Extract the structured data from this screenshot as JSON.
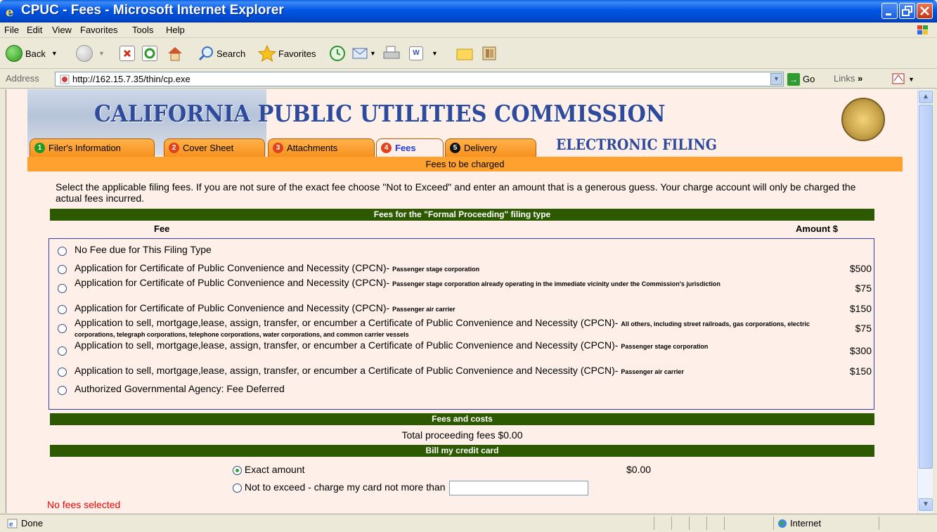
{
  "window": {
    "title": "CPUC - Fees - Microsoft Internet Explorer"
  },
  "menu": [
    "File",
    "Edit",
    "View",
    "Favorites",
    "Tools",
    "Help"
  ],
  "toolbar": {
    "back": "Back",
    "search": "Search",
    "favorites": "Favorites"
  },
  "address": {
    "label": "Address",
    "url": "http://162.15.7.35/thin/cp.exe",
    "go": "Go",
    "links": "Links"
  },
  "banner": {
    "title": "CALIFORNIA PUBLIC UTILITIES COMMISSION",
    "subtitle": "ELECTRONIC FILING"
  },
  "tabs": [
    {
      "num": "1",
      "label": "Filer's Information",
      "color": "#1f9a1f"
    },
    {
      "num": "2",
      "label": "Cover Sheet",
      "color": "#e2421a"
    },
    {
      "num": "3",
      "label": "Attachments",
      "color": "#e2421a"
    },
    {
      "num": "4",
      "label": "Fees",
      "color": "#e2421a"
    },
    {
      "num": "5",
      "label": "Delivery",
      "color": "#111111"
    }
  ],
  "page": {
    "header": "Fees to be charged",
    "intro": "Select the applicable filing fees. If you are not sure of the exact fee choose \"Not to Exceed\" and enter an amount that is a generous guess. Your charge account will only be charged the actual fees incurred.",
    "section_formal": "Fees for the \"Formal Proceeding\" filing type",
    "col_fee": "Fee",
    "col_amount": "Amount $",
    "fees": [
      {
        "main": "No Fee due for This Filing Type",
        "small": "",
        "amount": ""
      },
      {
        "main": "Application for Certificate of Public Convenience and Necessity (CPCN)-",
        "small": "Passenger stage corporation",
        "amount": "$500"
      },
      {
        "main": "Application for Certificate of Public Convenience and Necessity (CPCN)-",
        "small": "Passenger stage corporation already operating in the immediate vicinity under the Commission's jurisdiction",
        "amount": "$75"
      },
      {
        "main": "Application for Certificate of Public Convenience and Necessity (CPCN)-",
        "small": "Passenger air carrier",
        "amount": "$150"
      },
      {
        "main": "Application to sell, mortgage,lease, assign, transfer, or encumber a Certificate of Public Convenience and Necessity (CPCN)-",
        "small": "All others, including street railroads, gas corporations, electric corporations, telegraph corporations, telephone corporations, water corporations, and common carrier vessels",
        "amount": "$75"
      },
      {
        "main": "Application to sell, mortgage,lease, assign, transfer, or encumber a Certificate of Public Convenience and Necessity (CPCN)-",
        "small": "Passenger stage corporation",
        "amount": "$300"
      },
      {
        "main": "Application to sell, mortgage,lease, assign, transfer, or encumber a Certificate of Public Convenience and Necessity (CPCN)-",
        "small": "Passenger air carrier",
        "amount": "$150"
      },
      {
        "main": "Authorized Governmental Agency: Fee Deferred",
        "small": "",
        "amount": ""
      }
    ],
    "section_costs": "Fees and costs",
    "total": "Total proceeding fees $0.00",
    "section_bill": "Bill my credit card",
    "exact_label": "Exact amount",
    "exact_value": "$0.00",
    "not_exceed_label": "Not to exceed - charge my card not more than",
    "not_exceed_value": "",
    "error": "No fees selected"
  },
  "status": {
    "left": "Done",
    "zone": "Internet"
  }
}
